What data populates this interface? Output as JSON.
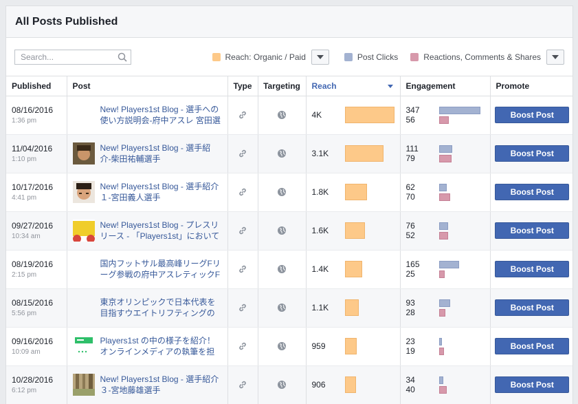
{
  "panel": {
    "title": "All Posts Published"
  },
  "search": {
    "placeholder": "Search..."
  },
  "legend": {
    "reach_label": "Reach: Organic / Paid",
    "clicks_label": "Post Clicks",
    "reactions_label": "Reactions, Comments & Shares",
    "colors": {
      "reach": "#fdc989",
      "clicks": "#a3b2d1",
      "reactions": "#d799ab"
    }
  },
  "columns": {
    "published": "Published",
    "post": "Post",
    "type": "Type",
    "targeting": "Targeting",
    "reach": "Reach",
    "engagement": "Engagement",
    "promote": "Promote"
  },
  "boost_label": "Boost Post",
  "rows": [
    {
      "date": "08/16/2016",
      "time": "1:36 pm",
      "thumb": "none",
      "title": "New! Players1st Blog - 選手への使い方説明会-府中アスレ 宮田選",
      "reach_text": "4K",
      "reach": 4000,
      "clicks": 347,
      "reactions": 56
    },
    {
      "date": "11/04/2016",
      "time": "1:10 pm",
      "thumb": "photo-face-1",
      "title": "New! Players1st Blog - 選手紹介-柴田祐輔選手",
      "reach_text": "3.1K",
      "reach": 3100,
      "clicks": 111,
      "reactions": 79
    },
    {
      "date": "10/17/2016",
      "time": "4:41 pm",
      "thumb": "photo-face-2",
      "title": "New! Players1st Blog - 選手紹介１-宮田義人選手",
      "reach_text": "1.8K",
      "reach": 1800,
      "clicks": 62,
      "reactions": 70
    },
    {
      "date": "09/27/2016",
      "time": "10:34 am",
      "thumb": "photo-yellow",
      "title": "New! Players1st Blog - プレスリリース - 「Players1st」において少",
      "reach_text": "1.6K",
      "reach": 1600,
      "clicks": 76,
      "reactions": 52
    },
    {
      "date": "08/19/2016",
      "time": "2:15 pm",
      "thumb": "none",
      "title": "国内フットサル最高峰リーグFリーグ参戦の府中アスレティックF",
      "reach_text": "1.4K",
      "reach": 1400,
      "clicks": 165,
      "reactions": 25
    },
    {
      "date": "08/15/2016",
      "time": "5:56 pm",
      "thumb": "none",
      "title": "東京オリンピックで日本代表を目指すウエイトリフティングの大塩",
      "reach_text": "1.1K",
      "reach": 1100,
      "clicks": 93,
      "reactions": 28
    },
    {
      "date": "09/16/2016",
      "time": "10:09 am",
      "thumb": "photo-green",
      "title": "Players1st の中の様子を紹介！オンラインメディアの執筆を担当",
      "reach_text": "959",
      "reach": 959,
      "clicks": 23,
      "reactions": 19
    },
    {
      "date": "10/28/2016",
      "time": "6:12 pm",
      "thumb": "photo-tree",
      "title": "New! Players1st Blog - 選手紹介３-宮地藤雄選手",
      "reach_text": "906",
      "reach": 906,
      "clicks": 34,
      "reactions": 40
    }
  ]
}
